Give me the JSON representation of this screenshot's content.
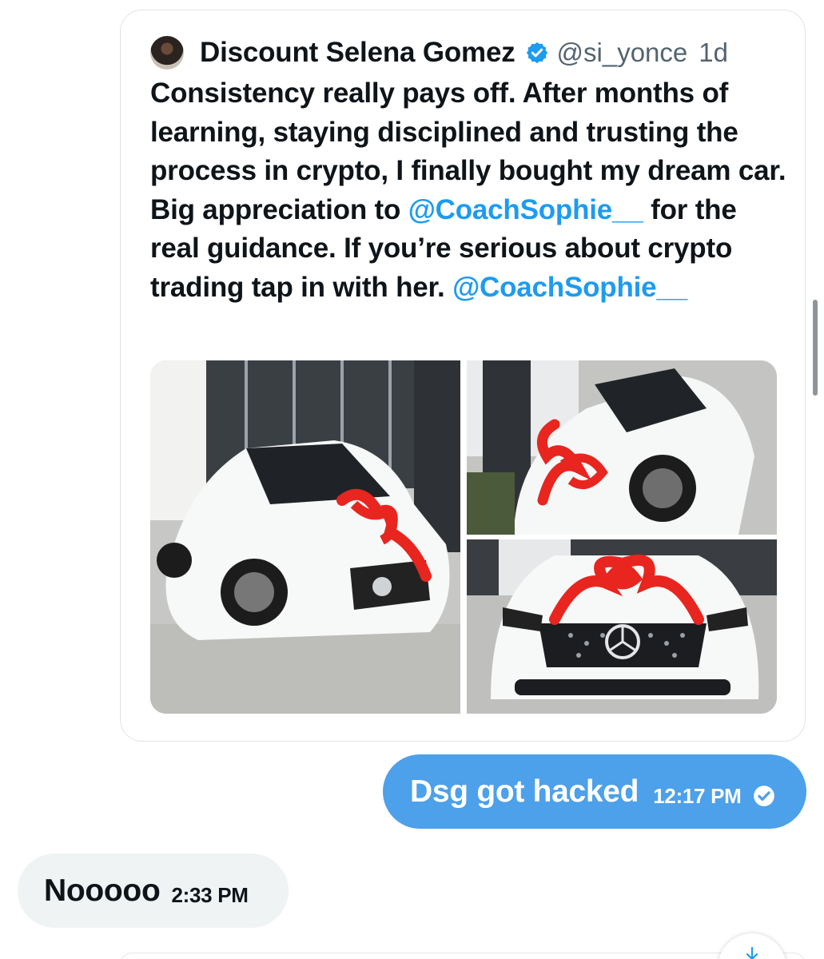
{
  "quoted_tweet": {
    "display_name": "Discount Selena Gomez",
    "handle": "@si_yonce",
    "time_ago": "1d",
    "verified": true,
    "avatar_icon": "user-avatar",
    "text_parts": {
      "line1": "Consistency really pays off. After months of learning, staying disciplined and trusting the process in crypto, I finally bought my dream car. Big appreciation to ",
      "mention1": "@CoachSophie__",
      "line2": " for the real guidance. If you’re serious about crypto trading tap in with her. ",
      "mention2": "@CoachSophie__"
    },
    "media": [
      {
        "description_icon": "car-photo"
      },
      {
        "description_icon": "car-photo"
      },
      {
        "description_icon": "car-photo"
      }
    ]
  },
  "messages": {
    "outgoing": {
      "text": "Dsg got hacked",
      "time": "12:17 PM",
      "status_icon": "read-check-icon"
    },
    "incoming": {
      "text": "Nooooo",
      "time": "2:33 PM"
    }
  },
  "colors": {
    "accent": "#1d9bf0",
    "outgoing_bubble": "#4da0ea",
    "incoming_bubble": "#eff3f4",
    "secondary_text": "#536471"
  }
}
